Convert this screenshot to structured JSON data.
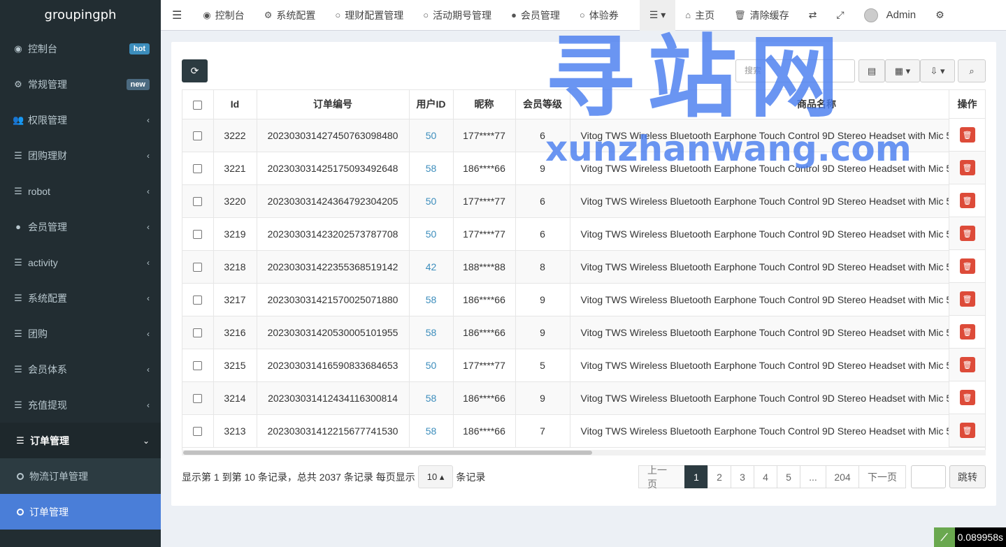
{
  "brand": "groupingph",
  "sidebar": {
    "items": [
      {
        "label": "控制台",
        "icon": "dashboard-icon",
        "glyph": "◉",
        "badge": "hot"
      },
      {
        "label": "常规管理",
        "icon": "cogs-icon",
        "glyph": "⚙",
        "badge": "new"
      },
      {
        "label": "权限管理",
        "icon": "users-icon",
        "glyph": "👥"
      },
      {
        "label": "团购理财",
        "icon": "list-icon",
        "glyph": "☰"
      },
      {
        "label": "robot",
        "icon": "list-icon",
        "glyph": "☰"
      },
      {
        "label": "会员管理",
        "icon": "user-circle-icon",
        "glyph": "●"
      },
      {
        "label": "activity",
        "icon": "list-icon",
        "glyph": "☰"
      },
      {
        "label": "系统配置",
        "icon": "list-icon",
        "glyph": "☰"
      },
      {
        "label": "团购",
        "icon": "list-icon",
        "glyph": "☰"
      },
      {
        "label": "会员体系",
        "icon": "list-icon",
        "glyph": "☰"
      },
      {
        "label": "充值提现",
        "icon": "list-icon",
        "glyph": "☰"
      }
    ],
    "open_item": {
      "label": "订单管理",
      "icon": "list-icon",
      "glyph": "☰"
    },
    "sub_items": [
      {
        "label": "物流订单管理"
      },
      {
        "label": "订单管理",
        "active": true
      }
    ]
  },
  "topbar": {
    "tabs": [
      {
        "label": "控制台",
        "icon": "dashboard-icon",
        "glyph": "◉"
      },
      {
        "label": "系统配置",
        "icon": "gear-icon",
        "glyph": "⚙"
      },
      {
        "label": "理财配置管理",
        "icon": "circle-icon",
        "glyph": "○"
      },
      {
        "label": "活动期号管理",
        "icon": "circle-icon",
        "glyph": "○"
      },
      {
        "label": "会员管理",
        "icon": "user-icon",
        "glyph": "●"
      },
      {
        "label": "体验券",
        "icon": "circle-icon",
        "glyph": "○"
      }
    ],
    "home_label": "主页",
    "clear_cache_label": "清除缓存",
    "admin_label": "Admin"
  },
  "toolbar": {
    "search_placeholder": "搜索"
  },
  "table": {
    "headers": {
      "id": "Id",
      "order_no": "订单编号",
      "user_id": "用户ID",
      "nickname": "昵称",
      "member_level": "会员等级",
      "goods_name": "商品名称",
      "action": "操作"
    },
    "rows": [
      {
        "id": "3222",
        "order_no": "202303031427450763098480",
        "user_id": "50",
        "nickname": "177****77",
        "level": "6",
        "goods": "Vitog TWS Wireless Bluetooth Earphone Touch Control 9D Stereo Headset with Mic 5"
      },
      {
        "id": "3221",
        "order_no": "202303031425175093492648",
        "user_id": "58",
        "nickname": "186****66",
        "level": "9",
        "goods": "Vitog TWS Wireless Bluetooth Earphone Touch Control 9D Stereo Headset with Mic 5"
      },
      {
        "id": "3220",
        "order_no": "202303031424364792304205",
        "user_id": "50",
        "nickname": "177****77",
        "level": "6",
        "goods": "Vitog TWS Wireless Bluetooth Earphone Touch Control 9D Stereo Headset with Mic 5"
      },
      {
        "id": "3219",
        "order_no": "202303031423202573787708",
        "user_id": "50",
        "nickname": "177****77",
        "level": "6",
        "goods": "Vitog TWS Wireless Bluetooth Earphone Touch Control 9D Stereo Headset with Mic 5"
      },
      {
        "id": "3218",
        "order_no": "202303031422355368519142",
        "user_id": "42",
        "nickname": "188****88",
        "level": "8",
        "goods": "Vitog TWS Wireless Bluetooth Earphone Touch Control 9D Stereo Headset with Mic 5"
      },
      {
        "id": "3217",
        "order_no": "202303031421570025071880",
        "user_id": "58",
        "nickname": "186****66",
        "level": "9",
        "goods": "Vitog TWS Wireless Bluetooth Earphone Touch Control 9D Stereo Headset with Mic 5"
      },
      {
        "id": "3216",
        "order_no": "202303031420530005101955",
        "user_id": "58",
        "nickname": "186****66",
        "level": "9",
        "goods": "Vitog TWS Wireless Bluetooth Earphone Touch Control 9D Stereo Headset with Mic 5"
      },
      {
        "id": "3215",
        "order_no": "202303031416590833684653",
        "user_id": "50",
        "nickname": "177****77",
        "level": "5",
        "goods": "Vitog TWS Wireless Bluetooth Earphone Touch Control 9D Stereo Headset with Mic 5"
      },
      {
        "id": "3214",
        "order_no": "202303031412434116300814",
        "user_id": "58",
        "nickname": "186****66",
        "level": "9",
        "goods": "Vitog TWS Wireless Bluetooth Earphone Touch Control 9D Stereo Headset with Mic 5"
      },
      {
        "id": "3213",
        "order_no": "202303031412215677741530",
        "user_id": "58",
        "nickname": "186****66",
        "level": "7",
        "goods": "Vitog TWS Wireless Bluetooth Earphone Touch Control 9D Stereo Headset with Mic 5"
      }
    ]
  },
  "footer": {
    "info_prefix": "显示第 1 到第 10 条记录，总共 2037 条记录 每页显示",
    "page_size": "10",
    "info_suffix": "条记录",
    "prev": "上一页",
    "pages": [
      "1",
      "2",
      "3",
      "4",
      "5",
      "...",
      "204"
    ],
    "next": "下一页",
    "jump": "跳转"
  },
  "watermark": {
    "cn": "寻站网",
    "en": "xunzhanwang.com"
  },
  "timer": "0.089958s",
  "colors": {
    "sidebar_bg": "#222d32",
    "active_sub": "#4a7ed8",
    "link": "#3c8dbc",
    "danger": "#dd4b39",
    "badge_hot": "#3c8dbc"
  }
}
